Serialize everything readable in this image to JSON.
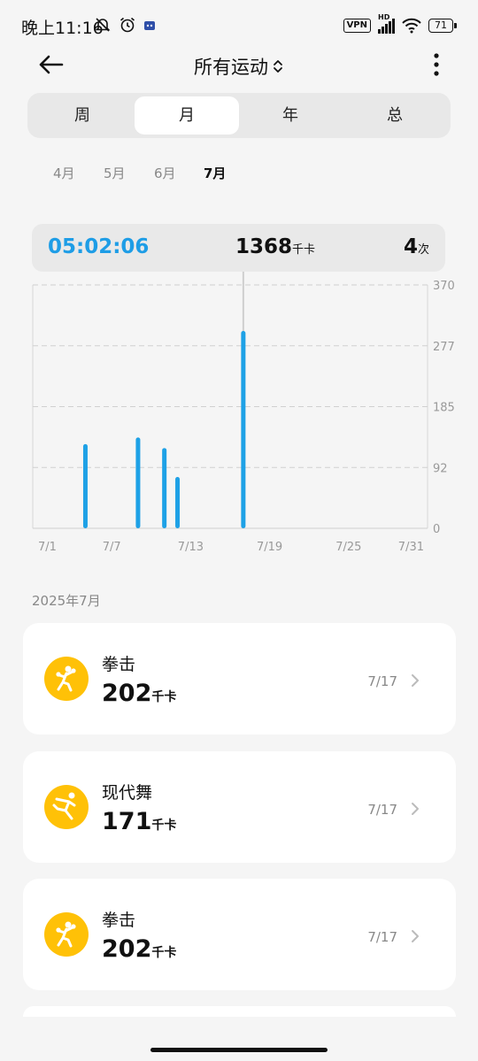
{
  "status_bar": {
    "time": "晚上11:16",
    "icons": [
      "mute-bell-icon",
      "alarm-icon",
      "app-notification-icon"
    ],
    "vpn": "VPN",
    "network": "HD",
    "battery": "71"
  },
  "nav": {
    "title": "所有运动",
    "icons": [
      "back-arrow-icon",
      "sort-toggle-icon",
      "more-vertical-icon"
    ]
  },
  "period_tabs": {
    "items": [
      "周",
      "月",
      "年",
      "总"
    ],
    "selected": "月"
  },
  "months": {
    "items": [
      "4月",
      "5月",
      "6月",
      "7月"
    ],
    "selected": "7月"
  },
  "summary": {
    "duration": "05:02:06",
    "calories": "1368",
    "calories_unit": "千卡",
    "count": "4",
    "count_unit": "次"
  },
  "chart_data": {
    "type": "bar",
    "x": [
      5,
      9,
      11,
      12,
      17
    ],
    "values": [
      128,
      138,
      122,
      78,
      300
    ],
    "xlim": [
      1,
      31
    ],
    "ylim": [
      0,
      370
    ],
    "x_tick_labels": [
      "7/1",
      "7/7",
      "7/13",
      "7/19",
      "7/25",
      "7/31"
    ],
    "y_tick_labels": [
      "0",
      "92",
      "185",
      "277",
      "370"
    ],
    "bar_color": "#1ea1e6",
    "grid": true,
    "highlight_x": 17
  },
  "list": {
    "section_date": "2025年7月",
    "unit": "千卡",
    "items": [
      {
        "name": "拳击",
        "calories": "202",
        "date": "7/17",
        "icon": "boxing-icon"
      },
      {
        "name": "现代舞",
        "calories": "171",
        "date": "7/17",
        "icon": "dance-icon"
      },
      {
        "name": "拳击",
        "calories": "202",
        "date": "7/17",
        "icon": "boxing-icon"
      }
    ]
  },
  "colors": {
    "accent": "#1e9de6",
    "icon_bg": "#ffc107"
  }
}
